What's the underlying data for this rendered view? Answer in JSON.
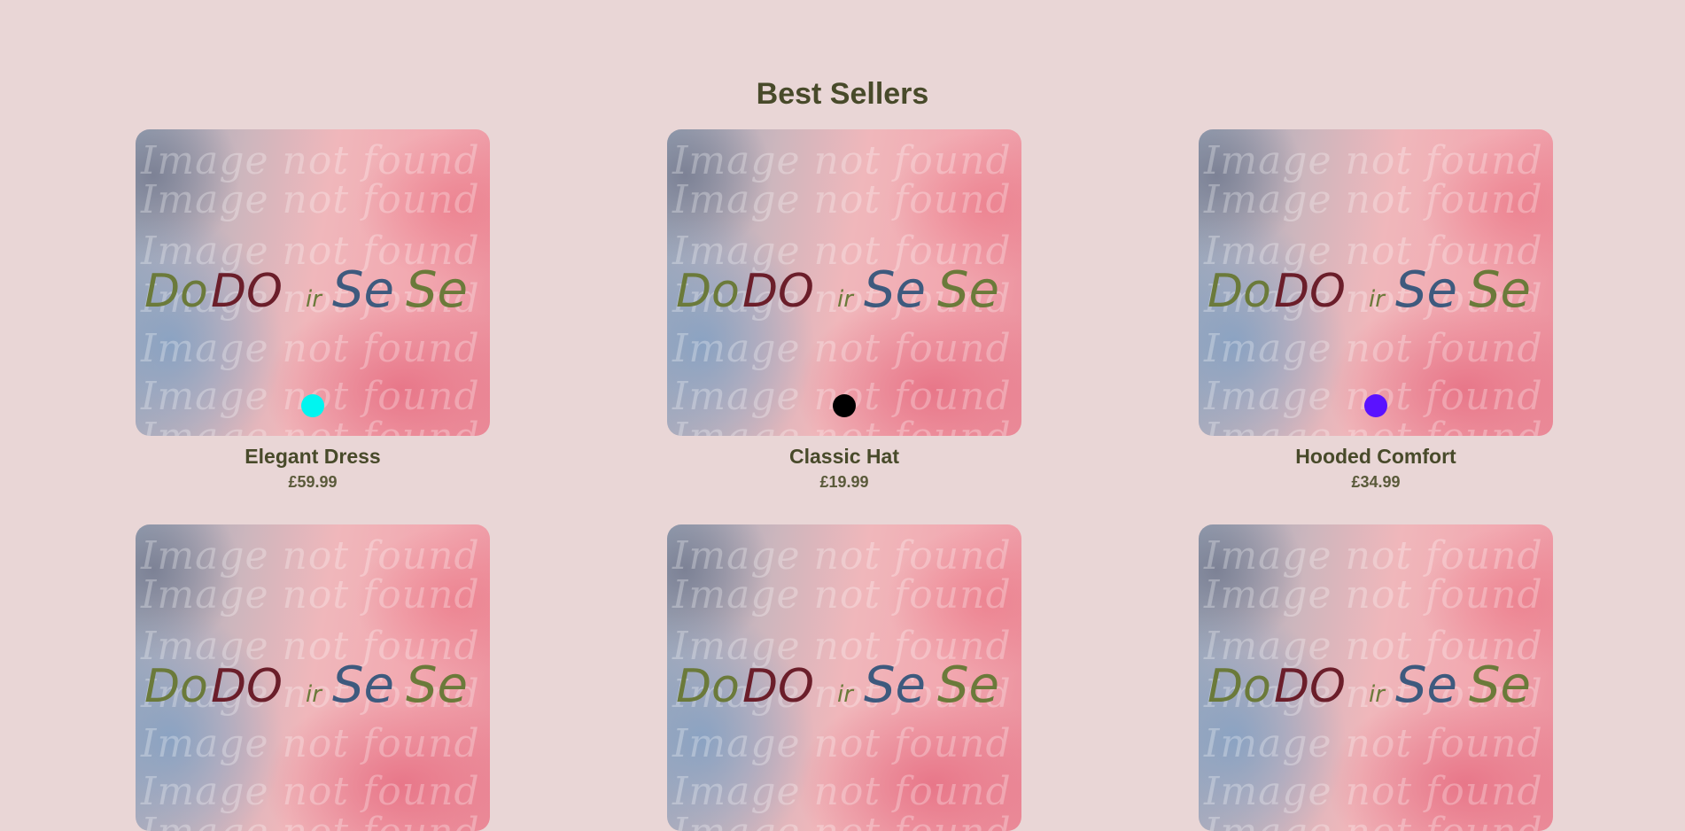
{
  "page": {
    "title": "Best Sellers",
    "background": "#e9d6d6",
    "text_color": "#484a2a"
  },
  "placeholder_image": {
    "alt": "Image not found",
    "watermark_text": "Image not found",
    "logo_text": [
      "Do",
      "DO",
      "ir",
      "Se",
      "Se"
    ],
    "logo_colors": [
      "#6b7a3a",
      "#6b1e2a",
      "#3e5a7e",
      "#6b7a3a",
      "#3e3f22"
    ]
  },
  "products": [
    {
      "name": "Elegant Dress",
      "price": "£59.99",
      "swatch_color": "#00f5f0",
      "swatch_icon": "color-dot-icon"
    },
    {
      "name": "Classic Hat",
      "price": "£19.99",
      "swatch_color": "#000000",
      "swatch_icon": "color-dot-icon"
    },
    {
      "name": "Hooded Comfort",
      "price": "£34.99",
      "swatch_color": "#5a12ff",
      "swatch_icon": "color-dot-icon"
    },
    {
      "name": "",
      "price": "",
      "swatch_color": "",
      "swatch_icon": ""
    },
    {
      "name": "",
      "price": "",
      "swatch_color": "",
      "swatch_icon": ""
    },
    {
      "name": "",
      "price": "",
      "swatch_color": "",
      "swatch_icon": ""
    }
  ]
}
